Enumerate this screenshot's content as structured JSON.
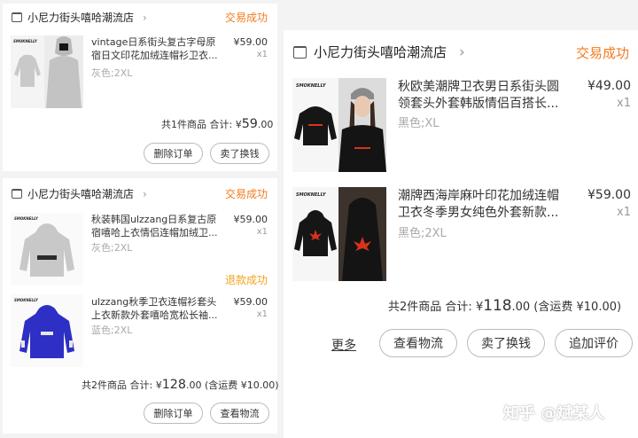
{
  "orders": [
    {
      "shop_name": "小尼力街头嘻哈潮流店",
      "status": "交易成功",
      "items": [
        {
          "title": "vintage日系街头复古字母原宿日文印花加绒连帽衫卫衣...",
          "price": "¥59.00",
          "qty": "x1",
          "sku": "灰色;2XL"
        }
      ],
      "summary": {
        "count_label": "共1件商品 合计:",
        "currency": "¥",
        "total": "59",
        "cents": ".00",
        "shipping": ""
      },
      "buttons": [
        "删除订单",
        "卖了换钱"
      ]
    },
    {
      "shop_name": "小尼力街头嘻哈潮流店",
      "status": "交易成功",
      "items": [
        {
          "title": "秋装韩国ulzzang日系复古原宿嘻哈上衣情侣连帽加绒卫...",
          "price": "¥59.00",
          "qty": "x1",
          "sku": "灰色;2XL",
          "status": ""
        },
        {
          "title": "ulzzang秋季卫衣连帽衫套头上衣新款外套嘻哈宽松长袖...",
          "price": "¥59.00",
          "qty": "x1",
          "sku": "蓝色;2XL",
          "status": "退款成功"
        }
      ],
      "summary": {
        "count_label": "共2件商品 合计:",
        "currency": "¥",
        "total": "128",
        "cents": ".00",
        "shipping": "(含运费 ¥10.00)"
      },
      "buttons": [
        "删除订单",
        "查看物流"
      ]
    },
    {
      "shop_name": "小尼力街头嘻哈潮流店",
      "status": "交易成功",
      "items": [
        {
          "title": "秋欧美潮牌卫衣男日系街头圆领套头外套韩版情侣百搭长...",
          "price": "¥49.00",
          "qty": "x1",
          "sku": "黑色;XL"
        },
        {
          "title": "潮牌西海岸麻叶印花加绒连帽卫衣冬季男女纯色外套新款...",
          "price": "¥59.00",
          "qty": "x1",
          "sku": "黑色;2XL"
        }
      ],
      "summary": {
        "count_label": "共2件商品 合计:",
        "currency": "¥",
        "total": "118",
        "cents": ".00",
        "shipping": "(含运费 ¥10.00)"
      },
      "more_label": "更多",
      "buttons": [
        "查看物流",
        "卖了换钱",
        "追加评价"
      ]
    }
  ],
  "brand_logo_text": "SMOKNELLY",
  "watermark": "知乎 @斌某人",
  "colors": {
    "status_orange": "#f27b1e",
    "refund_orange": "#f0a31a",
    "hoodie_grey": "#c8c8c8",
    "hoodie_blue": "#2e2fc4",
    "black": "#161616",
    "leaf_red": "#d8321e"
  }
}
